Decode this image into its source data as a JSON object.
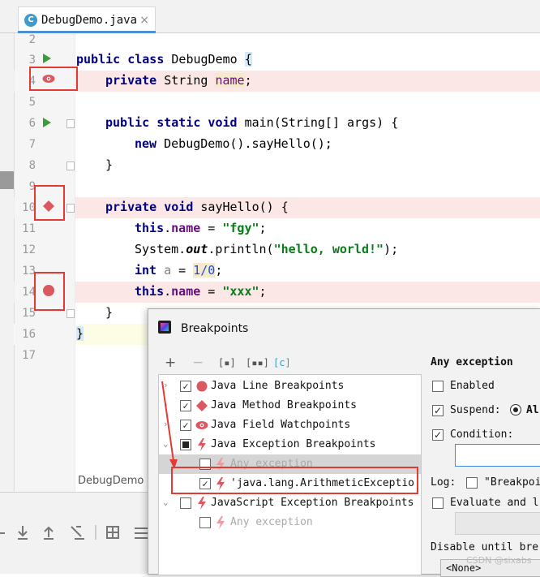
{
  "editor": {
    "tab_label": "DebugDemo.java",
    "tab_close": "×",
    "file_icon_letter": "C",
    "breadcrumb": "DebugDemo",
    "line_numbers": [
      "2",
      "3",
      "4",
      "5",
      "6",
      "7",
      "8",
      "9",
      "10",
      "11",
      "12",
      "13",
      "14",
      "15",
      "16",
      "17"
    ]
  },
  "code": {
    "l3_kw": "public class",
    "l3_name": " DebugDemo ",
    "l3_brace": "{",
    "l4_kw": "private",
    "l4_type": " String ",
    "l4_field": "name",
    "l4_end": ";",
    "l6_kw": "public static void",
    "l6_rest": " main(String[] args) {",
    "l7_kw": "new",
    "l7_rest": " DebugDemo().sayHello();",
    "l8": "}",
    "l10_kw": "private void",
    "l10_rest": " sayHello() {",
    "l11_kw": "this",
    "l11_dot": ".",
    "l11_field": "name",
    "l11_eq": " = ",
    "l11_str": "\"fgy\"",
    "l11_end": ";",
    "l12_a": "System.",
    "l12_out": "out",
    "l12_b": ".println(",
    "l12_str": "\"hello, world!\"",
    "l12_c": ");",
    "l13_kw": "int",
    "l13_var": " a",
    "l13_eq": " = ",
    "l13_val": "1/0",
    "l13_end": ";",
    "l14_kw": "this",
    "l14_dot": ".",
    "l14_field": "name",
    "l14_eq": " = ",
    "l14_str": "\"xxx\"",
    "l14_end": ";",
    "l15": "}",
    "l16": "}"
  },
  "dialog": {
    "title": "Breakpoints",
    "toolbar": {
      "add": "+",
      "remove": "−",
      "group1": "[▪]",
      "group2": "[▪▪]",
      "group3": "[c]"
    },
    "tree": [
      {
        "label": "Java Line Breakpoints",
        "checked": "✓",
        "arrow": "›"
      },
      {
        "label": "Java Method Breakpoints",
        "checked": "✓",
        "arrow": "›"
      },
      {
        "label": "Java Field Watchpoints",
        "checked": "✓",
        "arrow": "›"
      },
      {
        "label": "Java Exception Breakpoints",
        "checked": "",
        "arrow": "⌄"
      },
      {
        "label": "Any exception",
        "checked": ""
      },
      {
        "label": "'java.lang.ArithmeticExceptio",
        "checked": "✓"
      },
      {
        "label": "JavaScript Exception Breakpoints",
        "checked": "",
        "arrow": "⌄"
      },
      {
        "label": "Any exception",
        "checked": ""
      }
    ],
    "right": {
      "heading": "Any exception",
      "enabled": "Enabled",
      "suspend": "Suspend:",
      "suspend_opt": "Al",
      "condition": "Condition:",
      "log": "Log:",
      "log_opt": "\"Breakpoi",
      "evaluate": "Evaluate and l",
      "disable_until": "Disable until bre",
      "none_option": "<None>"
    }
  },
  "watermark": "CSDN @sixabs",
  "colors": {
    "breakpoint_red": "#db5860",
    "line_highlight": "#fbe8e6",
    "exec_line": "#fdfde6",
    "run_green": "#3b9c3b",
    "annotation_red": "#e53935"
  }
}
